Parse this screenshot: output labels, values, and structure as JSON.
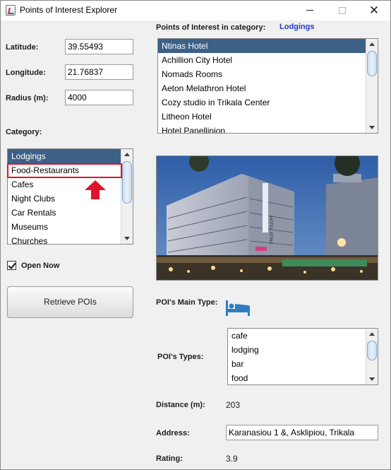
{
  "window": {
    "title": "Points of Interest Explorer",
    "app_icon": "java-cup-icon"
  },
  "form": {
    "latitude_label": "Latitude:",
    "latitude_value": "39.55493",
    "longitude_label": "Longitude:",
    "longitude_value": "21.76837",
    "radius_label": "Radius (m):",
    "radius_value": "4000",
    "category_label": "Category:",
    "open_now_label": "Open Now",
    "open_now_checked": true,
    "retrieve_button": "Retrieve POIs"
  },
  "categories": {
    "selected": "Lodgings",
    "items": [
      "Lodgings",
      "Food-Restaurants",
      "Cafes",
      "Night Clubs",
      "Car Rentals",
      "Museums",
      "Churches"
    ]
  },
  "poi_list": {
    "header_label": "Points of Interest in category:",
    "category": "Lodgings",
    "selected": "Ntinas Hotel",
    "items": [
      "Ntinas Hotel",
      "Achillion City Hotel",
      "Nomads Rooms",
      "Aeton Melathron Hotel",
      "Cozy studio in Trikala Center",
      "Litheon Hotel",
      "Hotel Panellinion"
    ]
  },
  "details": {
    "main_type_label": "POI's Main Type:",
    "main_type_icon": "bed-icon",
    "types_label": "POI's Types:",
    "types": [
      "cafe",
      "lodging",
      "bar",
      "food"
    ],
    "distance_label": "Distance (m):",
    "distance_value": "203",
    "address_label": "Address:",
    "address_value": "Karanasiou 1 &, Asklipiou, Trikala",
    "rating_label": "Rating:",
    "rating_value": "3.9",
    "photo_sign": "HOTEL NTINA"
  },
  "colors": {
    "selection": "#3d6186",
    "category_link": "#1f3bc9",
    "annotation": "#e0142a"
  }
}
